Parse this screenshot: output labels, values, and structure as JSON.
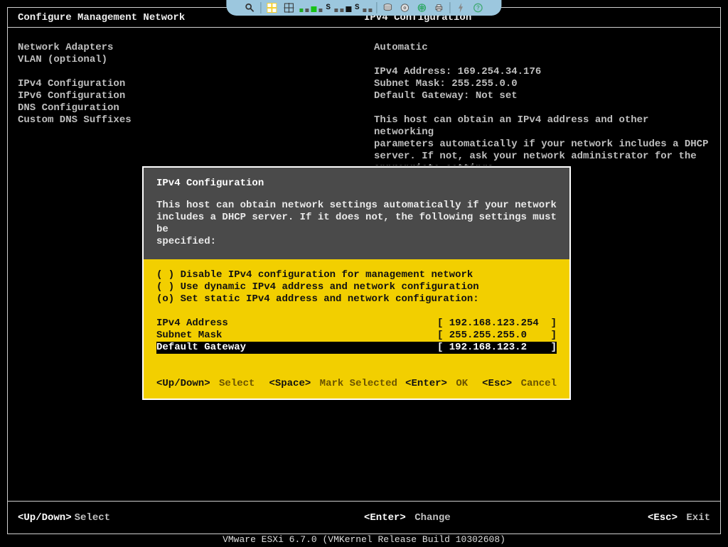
{
  "toolbar": {
    "icons": [
      "magnifier-icon",
      "grid-icon",
      "snap-icon",
      "dots-icon",
      "disk-icon",
      "cd-icon",
      "globe-icon",
      "printer-icon",
      "lightning-icon",
      "help-icon"
    ]
  },
  "title": {
    "left": "Configure Management Network",
    "right": "IPv4 Configuration"
  },
  "menu": {
    "items": [
      "Network Adapters",
      "VLAN (optional)",
      "",
      "IPv4 Configuration",
      "IPv6 Configuration",
      "DNS Configuration",
      "Custom DNS Suffixes"
    ]
  },
  "info": {
    "mode": "Automatic",
    "ipv4_label": "IPv4 Address:",
    "ipv4_value": "169.254.34.176",
    "mask_label": "Subnet Mask:",
    "mask_value": "255.255.0.0",
    "gw_label": "Default Gateway:",
    "gw_value": "Not set",
    "help1": "This host can obtain an IPv4 address and other networking",
    "help2": "parameters automatically if your network includes a DHCP",
    "help3": "server. If not, ask your network administrator for the",
    "help4": "appropriate settings."
  },
  "modal": {
    "title": "IPv4 Configuration",
    "desc1": "This host can obtain network settings automatically if your network",
    "desc2": "includes a DHCP server. If it does not, the following settings must be",
    "desc3": "specified:",
    "radios": [
      {
        "mark": "( )",
        "label": "Disable IPv4 configuration for management network"
      },
      {
        "mark": "( )",
        "label": "Use dynamic IPv4 address and network configuration"
      },
      {
        "mark": "(o)",
        "label": "Set static IPv4 address and network configuration:"
      }
    ],
    "fields": [
      {
        "label": "IPv4 Address",
        "value": "[ 192.168.123.254  ]",
        "selected": false
      },
      {
        "label": "Subnet Mask",
        "value": "[ 255.255.255.0    ]",
        "selected": false
      },
      {
        "label": "Default Gateway",
        "value": "[ 192.168.123.2    ]",
        "selected": true
      }
    ],
    "actions": {
      "updown_key": "<Up/Down>",
      "updown_label": "Select",
      "space_key": "<Space>",
      "space_label": "Mark Selected",
      "enter_key": "<Enter>",
      "enter_label": "OK",
      "esc_key": "<Esc>",
      "esc_label": "Cancel"
    }
  },
  "footer": {
    "updown_key": "<Up/Down>",
    "updown_label": "Select",
    "enter_key": "<Enter>",
    "enter_label": "Change",
    "esc_key": "<Esc>",
    "esc_label": "Exit"
  },
  "status": "VMware ESXi 6.7.0 (VMKernel Release Build 10302608)"
}
